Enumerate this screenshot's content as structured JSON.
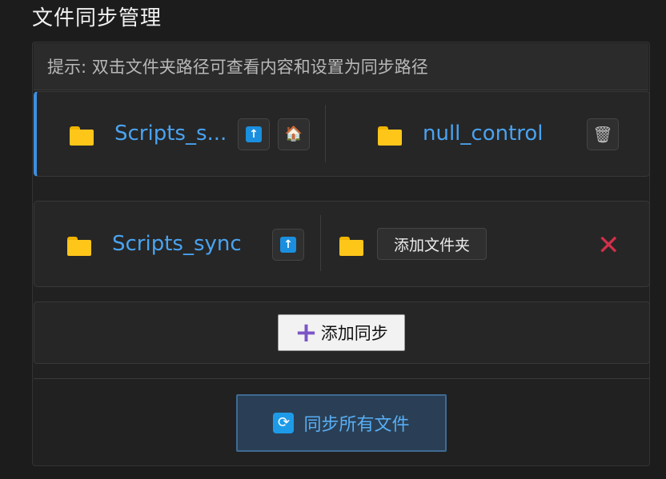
{
  "title": "文件同步管理",
  "hint": "提示: 双击文件夹路径可查看内容和设置为同步路径",
  "rows": [
    {
      "left": {
        "path": "Scripts_s...",
        "icons": [
          "folder-icon",
          "upload-icon",
          "home-icon"
        ]
      },
      "right": {
        "path": "null_control",
        "icons": [
          "folder-icon",
          "trash-icon"
        ]
      }
    },
    {
      "left": {
        "path": "Scripts_sync",
        "icons": [
          "folder-icon",
          "upload-icon"
        ]
      },
      "right": {
        "add_folder_label": "添加文件夹",
        "icons": [
          "folder-icon",
          "close-icon"
        ]
      }
    }
  ],
  "add_sync_label": "添加同步",
  "sync_all_label": "同步所有文件",
  "colors": {
    "accent": "#4aa3f0",
    "folder": "#ffc61a",
    "delete": "#d0304a",
    "add": "#7b55c7"
  }
}
